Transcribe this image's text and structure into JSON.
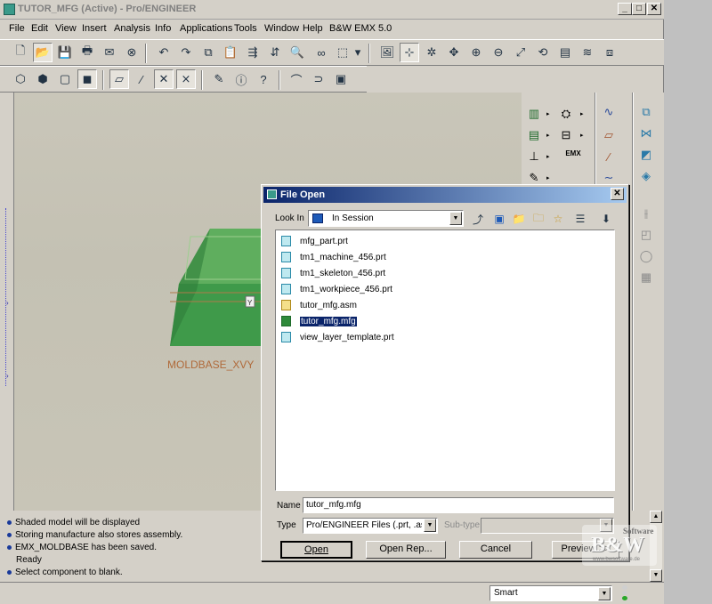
{
  "window": {
    "title": "TUTOR_MFG (Active) - Pro/ENGINEER"
  },
  "menu": [
    "File",
    "Edit",
    "View",
    "Insert",
    "Analysis",
    "Info",
    "Applications",
    "Tools",
    "Window",
    "Help",
    "B&W EMX 5.0"
  ],
  "viewport": {
    "model_label": "MOLDBASE_XVY",
    "csys_label": "Y"
  },
  "palette": {
    "emx_label": "EMX"
  },
  "dialog": {
    "title": "File Open",
    "look_in_label": "Look In",
    "look_in_value": "In Session",
    "files": [
      {
        "name": "mfg_part.prt",
        "icon": "part-file-icon",
        "selected": false
      },
      {
        "name": "tm1_machine_456.prt",
        "icon": "part-file-icon",
        "selected": false
      },
      {
        "name": "tm1_skeleton_456.prt",
        "icon": "part-file-icon",
        "selected": false
      },
      {
        "name": "tm1_workpiece_456.prt",
        "icon": "part-file-icon",
        "selected": false
      },
      {
        "name": "tutor_mfg.asm",
        "icon": "assembly-file-icon",
        "selected": false
      },
      {
        "name": "tutor_mfg.mfg",
        "icon": "manufacturing-file-icon",
        "selected": true
      },
      {
        "name": "view_layer_template.prt",
        "icon": "part-file-icon",
        "selected": false
      }
    ],
    "name_label": "Name",
    "name_value": "tutor_mfg.mfg",
    "type_label": "Type",
    "type_value": "Pro/ENGINEER Files (.prt, .asm",
    "subtype_label": "Sub-type",
    "buttons": {
      "open": "Open",
      "open_rep": "Open Rep...",
      "cancel": "Cancel",
      "preview": "Preview >>"
    }
  },
  "messages": [
    {
      "text": "Shaded model will be displayed",
      "bullet": true
    },
    {
      "text": "Storing manufacture also stores assembly.",
      "bullet": true
    },
    {
      "text": "EMX_MOLDBASE has been saved.",
      "bullet": true
    },
    {
      "text": "Ready",
      "bullet": false
    },
    {
      "text": "Select component to blank.",
      "bullet": true
    }
  ],
  "status": {
    "filter_value": "Smart"
  },
  "watermark": {
    "brand_line1": "B&W",
    "brand_line2": "Software",
    "brand_line3": "www.bwsoftware.de"
  },
  "colors": {
    "model_green": "#3f9a4a",
    "title_blue": "#0a246a",
    "selection_blue": "#0a246a"
  }
}
